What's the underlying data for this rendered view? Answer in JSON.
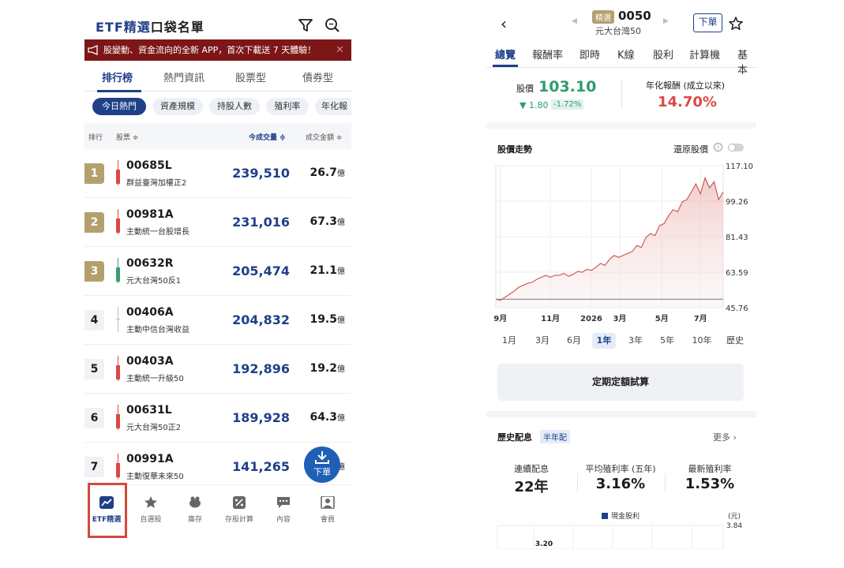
{
  "left": {
    "title_prefix": "ETF精選",
    "title_suffix": "口袋名單",
    "banner_text": "股變動、資金流向的全新 APP，首次下載送 7 天體驗！",
    "tabs": [
      "排行榜",
      "熱門資訊",
      "股票型",
      "債券型"
    ],
    "chips": [
      "今日熱門",
      "資產規模",
      "持股人數",
      "殖利率",
      "年化報"
    ],
    "columns": {
      "rank": "排行",
      "stock": "股票 ≑",
      "volume": "今成交量 ≑",
      "amount": "成交金額 ≑"
    },
    "rows": [
      {
        "rank": "1",
        "code": "00685L",
        "name": "群益臺灣加權正2",
        "volume": "239,510",
        "amount": "26.7",
        "unit": "億",
        "candle": "red"
      },
      {
        "rank": "2",
        "code": "00981A",
        "name": "主動統一台股增長",
        "volume": "231,016",
        "amount": "67.3",
        "unit": "億",
        "candle": "red"
      },
      {
        "rank": "3",
        "code": "00632R",
        "name": "元大台灣50反1",
        "volume": "205,474",
        "amount": "21.1",
        "unit": "億",
        "candle": "green"
      },
      {
        "rank": "4",
        "code": "00406A",
        "name": "主動中信台灣收益",
        "volume": "204,832",
        "amount": "19.5",
        "unit": "億",
        "candle": "flat"
      },
      {
        "rank": "5",
        "code": "00403A",
        "name": "主動統一升級50",
        "volume": "192,896",
        "amount": "19.2",
        "unit": "億",
        "candle": "red"
      },
      {
        "rank": "6",
        "code": "00631L",
        "name": "元大台灣50正2",
        "volume": "189,928",
        "amount": "64.3",
        "unit": "億",
        "candle": "red"
      },
      {
        "rank": "7",
        "code": "00991A",
        "name": "主動復華未來50",
        "volume": "141,265",
        "amount": "",
        "unit": "億",
        "candle": "red"
      }
    ],
    "fab_label": "下單",
    "nav": [
      "ETF精選",
      "自選股",
      "庫存",
      "存股計算",
      "內容",
      "會員"
    ]
  },
  "right": {
    "badge": "精選",
    "code": "0050",
    "name": "元大台灣50",
    "order_button": "下單",
    "tabs": [
      "總覽",
      "報酬率",
      "即時",
      "K線",
      "股利",
      "計算機",
      "基本"
    ],
    "price_label": "股價",
    "price": "103.10",
    "change": "▼ 1.80",
    "change_pct": "-1.72%",
    "annual_label": "年化報酬 (成立以來)",
    "annual_value": "14.70%",
    "chart_title": "股價走勢",
    "restore_label": "還原股價",
    "ranges": [
      "1月",
      "3月",
      "6月",
      "1年",
      "3年",
      "5年",
      "10年",
      "歷史"
    ],
    "active_range": "1年",
    "calc_button": "定期定額試算",
    "div_title": "歷史配息",
    "div_badge": "半年配",
    "more_link": "更多 ›",
    "stats": [
      {
        "label": "連續配息",
        "value": "22年"
      },
      {
        "label": "平均殖利率 (五年)",
        "value": "3.16%"
      },
      {
        "label": "最新殖利率",
        "value": "1.53%"
      }
    ],
    "div_legend": "現金股利",
    "div_unit": "(元)",
    "div_ymax": "3.84",
    "div_visible_value": "3.20"
  },
  "chart_data": [
    {
      "type": "area",
      "title": "股價走勢",
      "y_ticks": [
        "117.10",
        "99.26",
        "81.43",
        "63.59",
        "45.76"
      ],
      "ylim": [
        45.76,
        117.1
      ],
      "x_ticks": [
        "9月",
        "11月",
        "2026",
        "3月",
        "5月",
        "7月"
      ],
      "reference_value": 50,
      "series": [
        {
          "x": [
            0,
            0.02,
            0.04,
            0.06,
            0.08,
            0.1,
            0.12,
            0.14,
            0.16,
            0.18,
            0.2,
            0.22,
            0.24,
            0.26,
            0.28,
            0.3,
            0.32,
            0.34,
            0.36,
            0.38,
            0.4,
            0.42,
            0.44,
            0.46,
            0.48,
            0.5,
            0.52,
            0.54,
            0.56,
            0.58,
            0.6,
            0.62,
            0.64,
            0.66,
            0.68,
            0.7,
            0.72,
            0.74,
            0.76,
            0.78,
            0.8,
            0.82,
            0.84,
            0.86,
            0.88,
            0.9,
            0.92,
            0.94,
            0.96,
            0.98,
            1
          ],
          "values": [
            50,
            49.5,
            51,
            52.5,
            54,
            56,
            57,
            58,
            58.5,
            60,
            61,
            62,
            61,
            62,
            62,
            63,
            61.5,
            62.5,
            64,
            63.5,
            65,
            64.5,
            66,
            68,
            67,
            70,
            72,
            71,
            72,
            73,
            74,
            77,
            76,
            81,
            83,
            82,
            87,
            88,
            92,
            95,
            94,
            99,
            100,
            104,
            108,
            103,
            111,
            106,
            109,
            100,
            104
          ]
        }
      ]
    },
    {
      "type": "bar",
      "title": "",
      "legend": [
        "現金股利"
      ],
      "ylabel": "(元)",
      "y_max_tick": 3.84,
      "visible_value_labels": [
        3.2
      ]
    }
  ]
}
